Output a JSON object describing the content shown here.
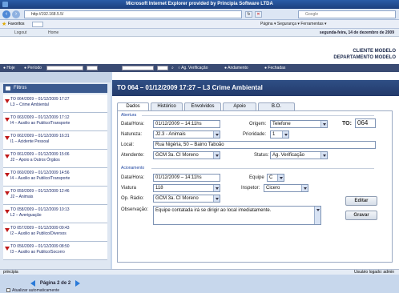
{
  "window": {
    "title": "Microsoft Internet Explorer provided by Principia Software LTDA"
  },
  "browser": {
    "address": "http://192.168.5.5/",
    "search_placeholder": "Google",
    "favorites_label": "Favoritos",
    "commands": "Página ▾  Segurança ▾  Ferramentas ▾"
  },
  "app": {
    "logout_label": "Logout",
    "home_label": "Home",
    "date_text": "segunda-feira, 14 de dezembro de 2009",
    "client_line1": "CLIENTE MODELO",
    "client_line2": "DEPARTAMENTO MODELO"
  },
  "filterbar": {
    "hoje": "Hoje",
    "periodo": "Período",
    "ag_verificacao": "Ag. Verificação",
    "andamento": "Andamento",
    "fechadas": "Fechadas"
  },
  "sidebar": {
    "filtros_label": "Filtros",
    "items": [
      {
        "line1": "TO 064/2009 – 01/12/2009 17:27",
        "line2": "L3 – Crime Ambiental"
      },
      {
        "line1": "TO 063/2009 – 01/12/2009 17:12",
        "line2": "I4 – Auxilio ao Publico/Transporte"
      },
      {
        "line1": "TO 062/2009 – 01/12/2009 16:31",
        "line2": "I1 – Acidente Pessoal"
      },
      {
        "line1": "TO 061/2009 – 01/12/2009 15:06",
        "line2": "J2 – Apoio a Outros Órgãos"
      },
      {
        "line1": "TO 060/2009 – 01/12/2009 14:56",
        "line2": "I4 – Auxilio ao Publico/Transporte"
      },
      {
        "line1": "TO 059/2009 – 01/12/2009 12:46",
        "line2": "J2 – Animais"
      },
      {
        "line1": "TO 058/2009 – 01/12/2009 10:13",
        "line2": "L2 – Averiguação"
      },
      {
        "line1": "TO 057/2009 – 01/12/2009 09:43",
        "line2": "I2 – Auxilio ao Publico/Diversos"
      },
      {
        "line1": "TO 056/2009 – 01/12/2009 08:50",
        "line2": "I3 – Auxilio ao Publico/Socorro"
      }
    ],
    "pager_text": "Página 2 de 2",
    "auto_update_label": "Atualizar automaticamente"
  },
  "main": {
    "title": "TO 064 – 01/12/2009 17:27 – L3 Crime Ambiental",
    "tabs": [
      "Dados",
      "Histórico",
      "Envolvidos",
      "Apoio",
      "B.O."
    ],
    "abertura": {
      "section_label": "Abertura",
      "datahora_label": "Data/Hora:",
      "datahora_value": "01/12/2009 – 14:11hs",
      "origem_label": "Origem:",
      "origem_value": "Telefone",
      "to_label": "TO:",
      "to_value": "064",
      "natureza_label": "Natureza:",
      "natureza_value": "J2.3 - Animais",
      "prioridade_label": "Prioridade:",
      "prioridade_value": "1",
      "local_label": "Local:",
      "local_value": "Rua Nigéria, 50 – Bairro Taboão",
      "atendente_label": "Atendente:",
      "atendente_value": "GCM 3a. CI Moreno",
      "status_label": "Status:",
      "status_value": "Ag. Verificação"
    },
    "acionamento": {
      "section_label": "Acionamento",
      "datahora_label": "Data/Hora:",
      "datahora_value": "01/12/2009 – 14:11hs",
      "equipe_label": "Equipe",
      "equipe_value": "C",
      "viatura_label": "Viatura",
      "viatura_value": "118",
      "inspetor_label": "Inspetor:",
      "inspetor_value": "Cicero",
      "opradio_label": "Op. Rádio:",
      "opradio_value": "GCM 3a. CI Moreno",
      "observacao_label": "Observação:",
      "observacao_value": "Equipe contatada irá se dirigir ao local imediatamente."
    },
    "editar_label": "Editar",
    "gravar_label": "Gravar"
  },
  "status": {
    "left": "principia",
    "right": "Usuário logado: admin"
  }
}
